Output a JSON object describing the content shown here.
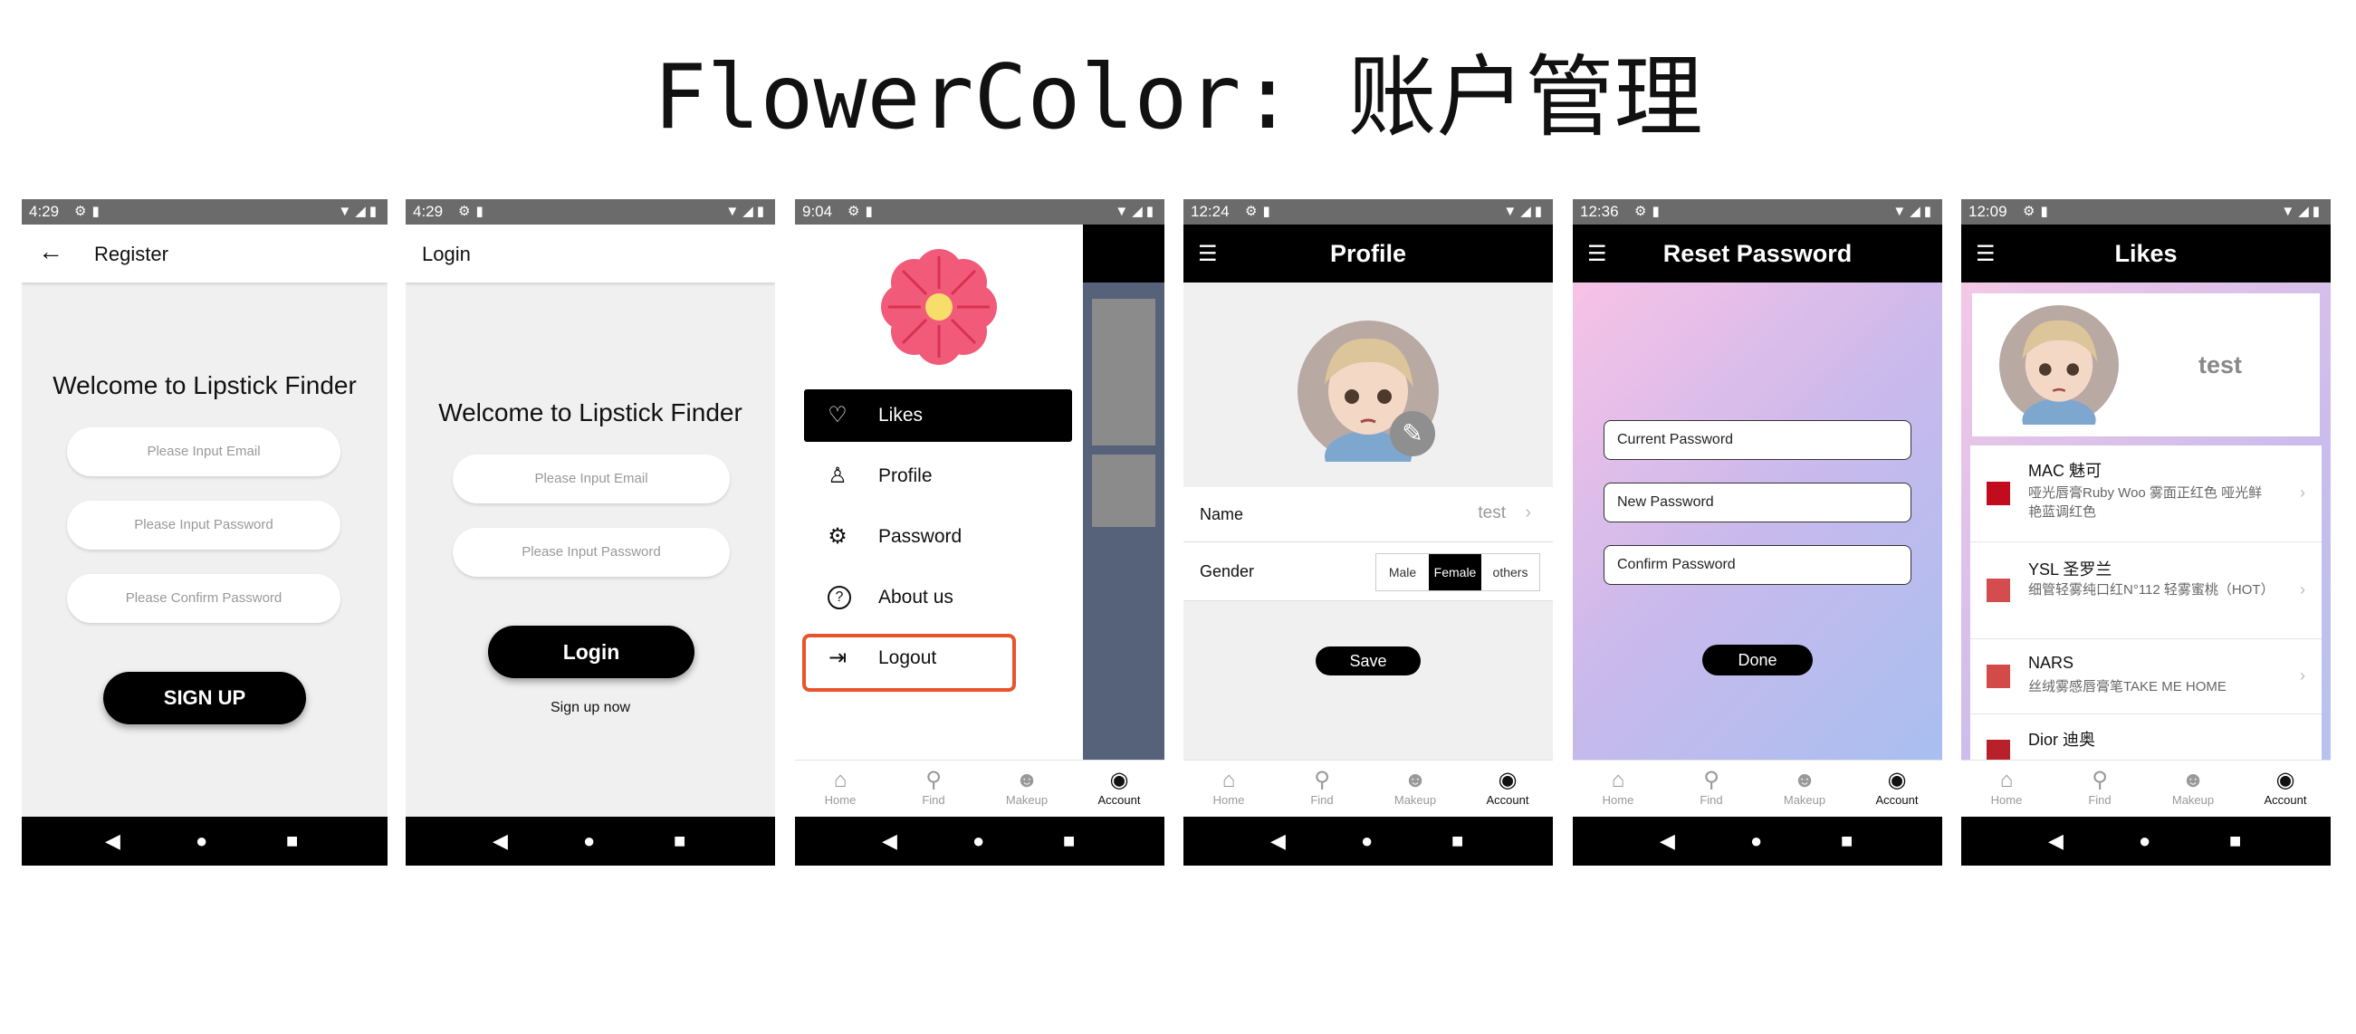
{
  "page": {
    "title": "FlowerColor: 账户管理"
  },
  "nav_buttons": {
    "back": "◀",
    "home": "●",
    "recent": "■"
  },
  "tabs": [
    {
      "icon": "⌂",
      "label": "Home"
    },
    {
      "icon": "⚲",
      "label": "Find"
    },
    {
      "icon": "☻",
      "label": "Makeup"
    },
    {
      "icon": "◉",
      "label": "Account"
    }
  ],
  "register": {
    "time": "4:29",
    "title": "Register",
    "back_icon": "←",
    "welcome": "Welcome to Lipstick Finder",
    "email_placeholder": "Please Input Email",
    "password_placeholder": "Please Input Password",
    "confirm_placeholder": "Please Confirm Password",
    "signup": "SIGN UP"
  },
  "login": {
    "time": "4:29",
    "title": "Login",
    "welcome": "Welcome to Lipstick Finder",
    "email_placeholder": "Please Input Email",
    "password_placeholder": "Please Input Password",
    "login": "Login",
    "signup_link": "Sign up now"
  },
  "drawer": {
    "time": "9:04",
    "items": [
      {
        "icon": "♡",
        "label": "Likes",
        "selected": true
      },
      {
        "icon": "♙",
        "label": "Profile"
      },
      {
        "icon": "⚙",
        "label": "Password"
      },
      {
        "icon": "?",
        "label": "About us"
      },
      {
        "icon": "⇥",
        "label": "Logout",
        "highlighted": true
      }
    ],
    "highlight_color": "#e8532a"
  },
  "profile": {
    "time": "12:24",
    "title": "Profile",
    "edit_icon": "✎",
    "name_label": "Name",
    "name_value": "test",
    "chevron": "›",
    "gender_label": "Gender",
    "gender_options": [
      "Male",
      "Female",
      "others"
    ],
    "gender_selected": "Female",
    "save": "Save"
  },
  "reset": {
    "time": "12:36",
    "title": "Reset Password",
    "current": "Current Password",
    "new": "New Password",
    "confirm": "Confirm Password",
    "done": "Done",
    "gradient": [
      "#f8c2e6",
      "#a8bff0"
    ]
  },
  "likes": {
    "time": "12:09",
    "title": "Likes",
    "username": "test",
    "chevron": "›",
    "items": [
      {
        "brand": "MAC 魅可",
        "desc": "哑光唇膏Ruby Woo 雾面正红色 哑光鲜艳蓝调红色",
        "color": "#c20c1e"
      },
      {
        "brand": "YSL 圣罗兰",
        "desc": "细管轻雾纯口红N°112 轻雾蜜桃（HOT）",
        "color": "#d44c4e"
      },
      {
        "brand": "NARS",
        "desc": "丝绒雾感唇膏笔TAKE ME HOME",
        "color": "#d24b48"
      },
      {
        "brand": "Dior 迪奥",
        "desc": "",
        "color": "#b8202a"
      }
    ]
  },
  "colors": {
    "accent": "#000000",
    "background": "#f0f0f0",
    "status_bar": "#6b6b6b",
    "flower": "#f25a7a"
  }
}
